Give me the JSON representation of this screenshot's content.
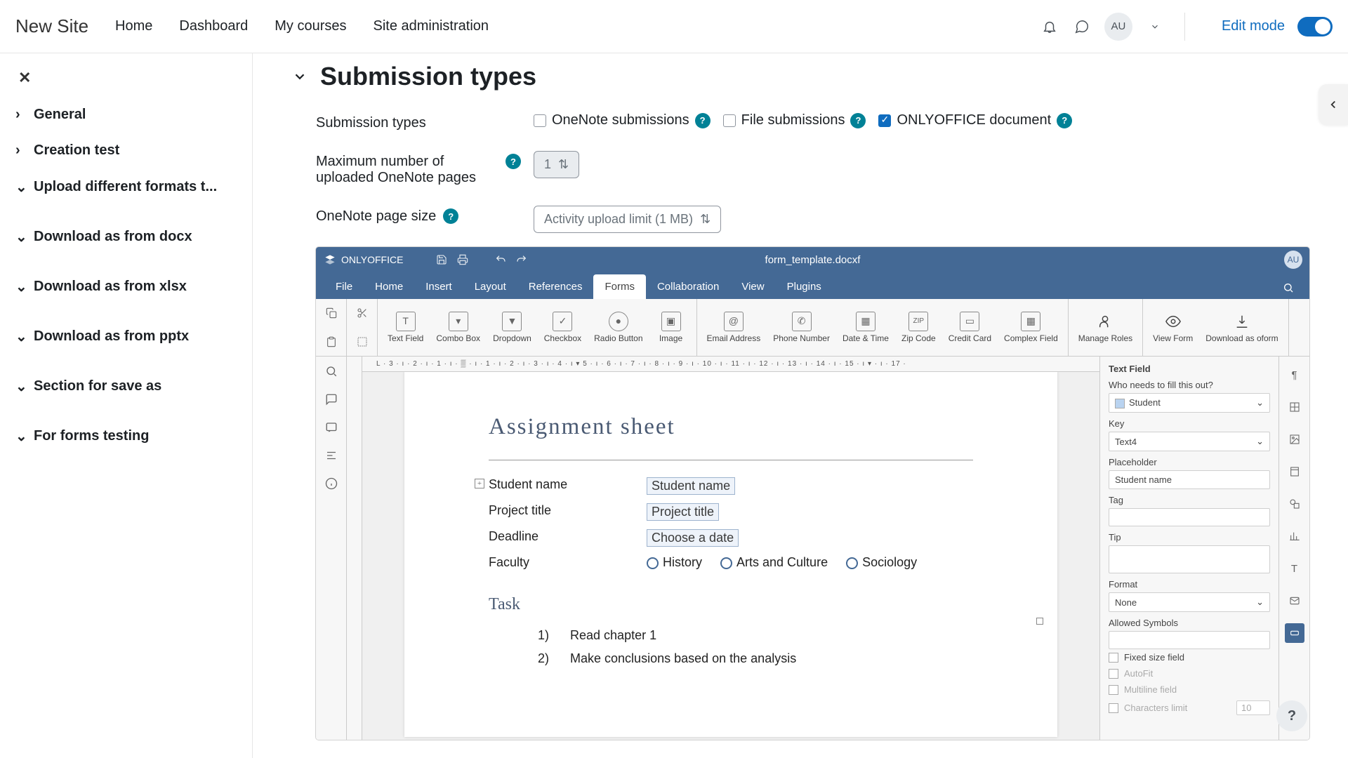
{
  "brand": "New Site",
  "nav": [
    "Home",
    "Dashboard",
    "My courses",
    "Site administration"
  ],
  "avatar": "AU",
  "editmode": "Edit mode",
  "sidebar": [
    {
      "icon": ">",
      "label": "General"
    },
    {
      "icon": ">",
      "label": "Creation test"
    },
    {
      "icon": "v",
      "label": "Upload different formats t..."
    },
    {
      "icon": "v",
      "label": "Download as from docx"
    },
    {
      "icon": "v",
      "label": "Download as from xlsx"
    },
    {
      "icon": "v",
      "label": "Download as from pptx"
    },
    {
      "icon": "v",
      "label": "Section for save as"
    },
    {
      "icon": "v",
      "label": "For forms testing"
    }
  ],
  "section": {
    "title": "Submission types",
    "row1_label": "Submission types",
    "opts": [
      {
        "label": "OneNote submissions",
        "checked": false
      },
      {
        "label": "File submissions",
        "checked": false
      },
      {
        "label": "ONLYOFFICE document",
        "checked": true
      }
    ],
    "row2_label": "Maximum number of uploaded OneNote pages",
    "row2_value": "1",
    "row3_label": "OneNote page size",
    "row3_value": "Activity upload limit (1 MB)"
  },
  "oo": {
    "brand": "ONLYOFFICE",
    "file": "form_template.docxf",
    "avatar": "AU",
    "tabs": [
      "File",
      "Home",
      "Insert",
      "Layout",
      "References",
      "Forms",
      "Collaboration",
      "View",
      "Plugins"
    ],
    "active_tab": "Forms",
    "ribbon": [
      "Text Field",
      "Combo Box",
      "Dropdown",
      "Checkbox",
      "Radio Button",
      "Image",
      "Email Address",
      "Phone Number",
      "Date & Time",
      "Zip Code",
      "Credit Card",
      "Complex Field",
      "Manage Roles",
      "View Form",
      "Download as oform"
    ],
    "ruler": "L    · 3 · ı · 2 · ı · 1 · ı · ▒ · ı · 1 · ı · 2 · ı · 3 · ı · 4 · ı ▾ 5 · ı · 6 · ı · 7 · ı · 8 · ı · 9 · ı · 10 · ı · 11 · ı · 12 · ı · 13 · ı · 14 · ı · 15 · ı ▾ · ı · 17 ·",
    "doc": {
      "title": "Assignment  sheet",
      "rows": [
        {
          "lab": "Student name",
          "val": "Student name",
          "field": true
        },
        {
          "lab": "Project title",
          "val": "Project title",
          "field": true
        },
        {
          "lab": "Deadline",
          "val": "Choose a date",
          "field": true
        }
      ],
      "faculty_lab": "Faculty",
      "faculty": [
        "History",
        "Arts and Culture",
        "Sociology"
      ],
      "task_head": "Task",
      "tasks": [
        {
          "n": "1)",
          "t": "Read chapter 1"
        },
        {
          "n": "2)",
          "t": "Make conclusions based on the analysis"
        }
      ]
    },
    "props": {
      "title": "Text Field",
      "who_label": "Who needs to fill this out?",
      "who": "Student",
      "key_label": "Key",
      "key": "Text4",
      "ph_label": "Placeholder",
      "ph": "Student name",
      "tag_label": "Tag",
      "tag": "",
      "tip_label": "Tip",
      "tip": "",
      "format_label": "Format",
      "format": "None",
      "allowed_label": "Allowed Symbols",
      "allowed": "",
      "fixed": "Fixed size field",
      "autofit": "AutoFit",
      "multiline": "Multiline field",
      "charlimit": "Characters limit",
      "charlimit_val": "10"
    }
  },
  "help": "?"
}
